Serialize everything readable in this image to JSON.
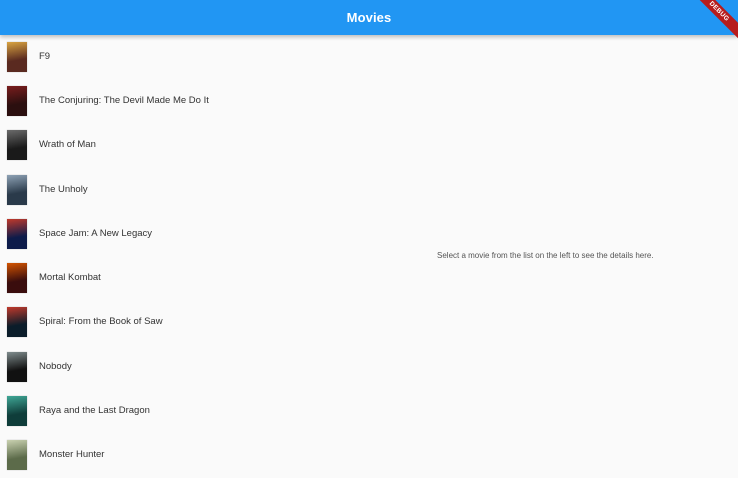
{
  "appbar": {
    "title": "Movies",
    "debug_label": "DEBUG",
    "color": "#2196f3"
  },
  "movies": [
    {
      "title": "F9",
      "poster_colors": [
        "#5a2a20",
        "#d9a441"
      ]
    },
    {
      "title": "The Conjuring: The Devil Made Me Do It",
      "poster_colors": [
        "#2b0f0f",
        "#7a1d1d"
      ]
    },
    {
      "title": "Wrath of Man",
      "poster_colors": [
        "#1a1a1a",
        "#6b6b6b"
      ]
    },
    {
      "title": "The Unholy",
      "poster_colors": [
        "#2a3a4a",
        "#8ea2b5"
      ]
    },
    {
      "title": "Space Jam: A New Legacy",
      "poster_colors": [
        "#0d1b4a",
        "#c0392b"
      ]
    },
    {
      "title": "Mortal Kombat",
      "poster_colors": [
        "#3a0d0d",
        "#d35400"
      ]
    },
    {
      "title": "Spiral: From the Book of Saw",
      "poster_colors": [
        "#0b1d2a",
        "#c0392b"
      ]
    },
    {
      "title": "Nobody",
      "poster_colors": [
        "#111111",
        "#7f8c8d"
      ]
    },
    {
      "title": "Raya and the Last Dragon",
      "poster_colors": [
        "#0f3d3a",
        "#3fa796"
      ]
    },
    {
      "title": "Monster Hunter",
      "poster_colors": [
        "#5c6b4a",
        "#c9d1b0"
      ]
    }
  ],
  "detail": {
    "placeholder": "Select a movie from the list on the left to see the details here."
  }
}
